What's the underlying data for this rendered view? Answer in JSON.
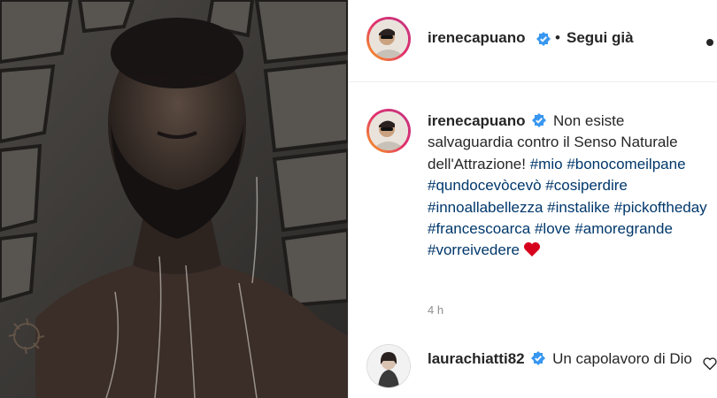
{
  "post": {
    "image_alt": "Shirtless bearded man with eyes closed under a shower against a stone wall",
    "author": {
      "username": "irenecapuano",
      "verified": true,
      "separator": "•",
      "follow_label": "Segui già"
    },
    "caption": {
      "username": "irenecapuano",
      "text_before": "Non esiste salvaguardia contro il Senso Naturale dell'Attrazione!",
      "hashtags": [
        "#mio",
        "#bonocomeilpane",
        "#qundocevòcevò",
        "#cosiperdire",
        "#innoallabellezza",
        "#instalike",
        "#pickoftheday",
        "#francescoarca",
        "#love",
        "#amoregrande",
        "#vorreivedere"
      ],
      "emoji": "red-heart-icon"
    },
    "time_ago": "4 h",
    "comments": [
      {
        "username": "laurachiatti82",
        "verified": true,
        "text": "Un capolavoro di Dio"
      }
    ]
  },
  "colors": {
    "hashtag": "#00376b",
    "verified": "#3897f0",
    "muted": "#8e8e8e",
    "heart": "#ed4956",
    "ring": "#e1306c"
  }
}
